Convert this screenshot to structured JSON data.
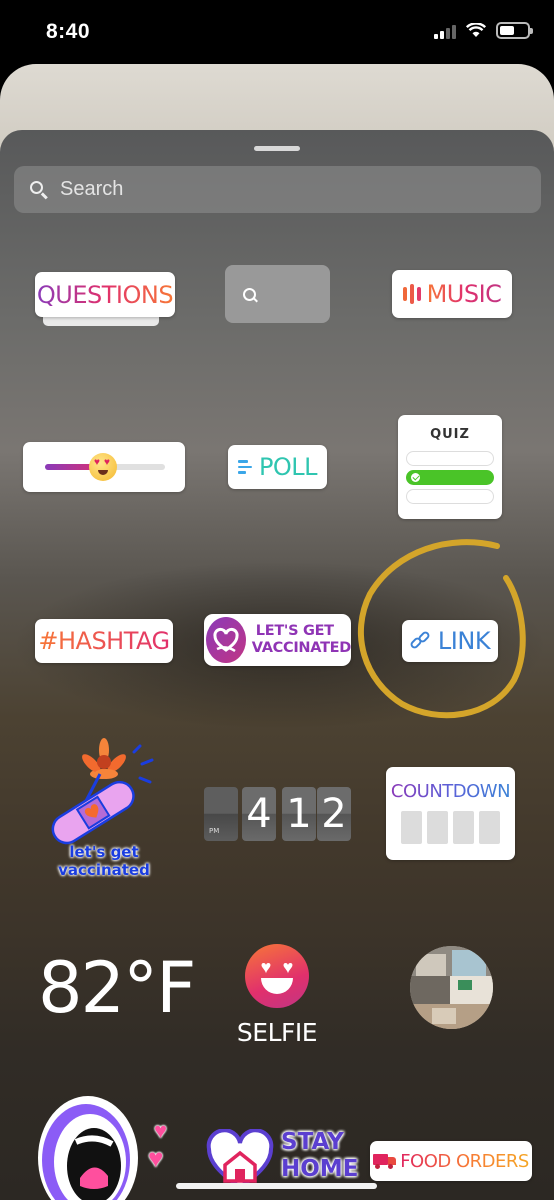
{
  "status_bar": {
    "time": "8:40"
  },
  "search": {
    "placeholder": "Search"
  },
  "stickers": {
    "questions": "QUESTIONS",
    "music": "MUSIC",
    "poll": "POLL",
    "quiz": "QUIZ",
    "hashtag": "#HASHTAG",
    "vaccinated_line1": "LET'S GET",
    "vaccinated_line2": "VACCINATED",
    "link": "LINK",
    "vaccinated_art_line1": "let's get",
    "vaccinated_art_line2": "vaccinated",
    "clock_hour": "4",
    "clock_minute_tens": "1",
    "clock_minute_ones": "2",
    "clock_meridiem": "PM",
    "countdown": "COUNTDOWN",
    "temperature": "82°F",
    "selfie": "SELFIE",
    "stay_home_line1": "STAY",
    "stay_home_line2": "HOME",
    "food_orders": "FOOD ORDERS"
  },
  "icons": [
    "search-icon",
    "music-bars-icon",
    "heart-eyes-emoji-icon",
    "poll-lines-icon",
    "quiz-check-icon",
    "heart-icon",
    "link-icon",
    "bandage-flower-icon",
    "selfie-face-icon",
    "photo-collage-icon",
    "mouth-icon",
    "house-icon",
    "truck-icon"
  ],
  "colors": {
    "annotation_circle": "#d4a52a",
    "link_blue": "#3b82d6",
    "poll_teal": "#2fc5b0",
    "quiz_green": "#4ac428",
    "vaccinated_purple": "#8f34b5",
    "stay_home_purple": "#5b3fd0"
  }
}
